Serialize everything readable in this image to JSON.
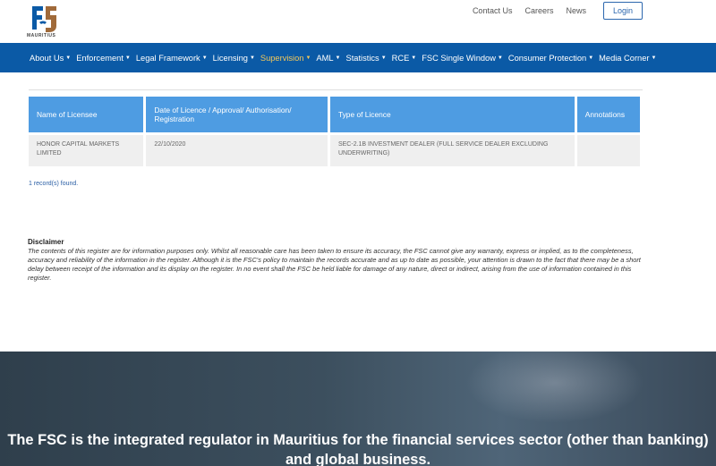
{
  "header": {
    "logo_text": "MAURITIUS",
    "links": [
      "Contact Us",
      "Careers",
      "News"
    ],
    "login_label": "Login"
  },
  "nav": {
    "items": [
      {
        "label": "About Us"
      },
      {
        "label": "Enforcement"
      },
      {
        "label": "Legal Framework"
      },
      {
        "label": "Licensing"
      },
      {
        "label": "Supervision"
      },
      {
        "label": "AML"
      },
      {
        "label": "Statistics"
      },
      {
        "label": "RCE"
      },
      {
        "label": "FSC Single Window"
      },
      {
        "label": "Consumer Protection"
      },
      {
        "label": "Media Corner"
      }
    ],
    "active_color": "#f3c85a",
    "bg_color": "#0b5aa6"
  },
  "table": {
    "headers": [
      "Name of Licensee",
      "Date of Licence / Approval/ Authorisation/ Registration",
      "Type of Licence",
      "Annotations"
    ],
    "rows": [
      [
        "HONOR CAPITAL MARKETS LIMITED",
        "22/10/2020",
        "SEC-2.1B INVESTMENT DEALER (FULL SERVICE DEALER EXCLUDING UNDERWRITING)",
        ""
      ]
    ]
  },
  "records_text": "1 record(s) found.",
  "disclaimer": {
    "title": "Disclaimer",
    "body": "The contents of this register are for information purposes only. Whilst all reasonable care has been taken to ensure its accuracy, the FSC cannot give any warranty, express or implied, as to the completeness, accuracy and reliability of the information in the register. Although it is the FSC's policy to maintain the records accurate and as up to date as possible, your attention is drawn to the fact that there may be a short delay between receipt of the information and its display on the register. In no event shall the FSC be held liable for damage of any nature, direct or indirect, arising from the use of information contained in this register."
  },
  "banner": {
    "text": "The FSC is the integrated regulator in Mauritius for the financial services sector (other than banking) and global business."
  }
}
